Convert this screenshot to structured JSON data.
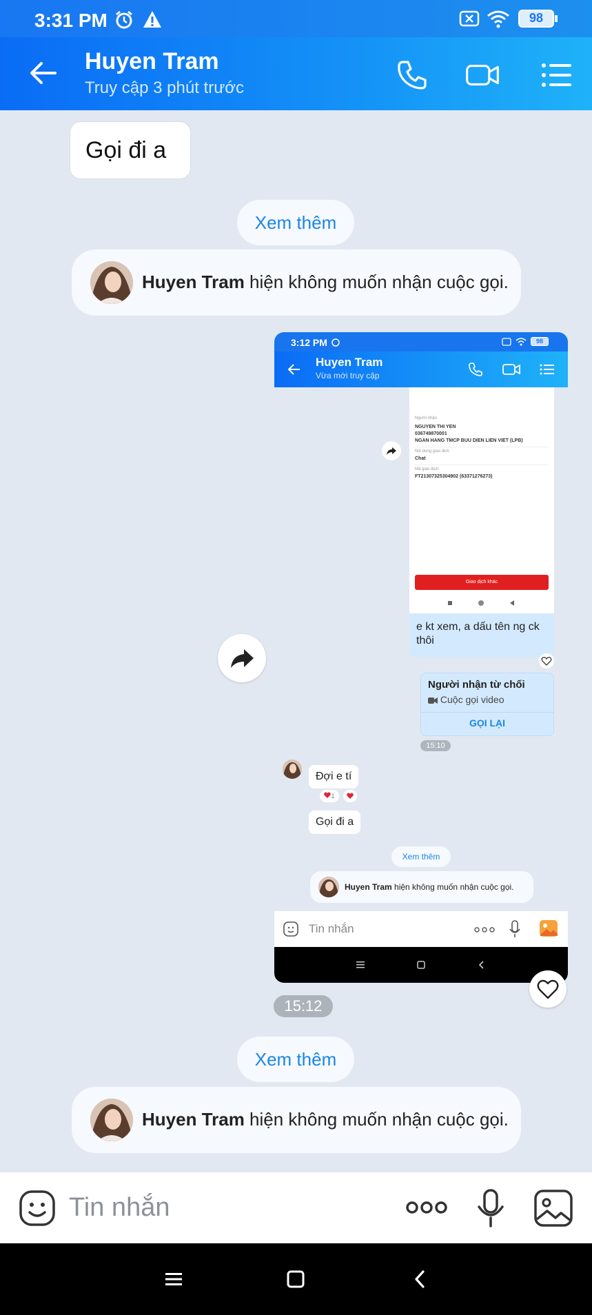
{
  "status_bar": {
    "time": "3:31 PM",
    "battery": "98",
    "icons": [
      "alarm-icon",
      "warning-icon",
      "no-sim-icon",
      "wifi-icon",
      "battery-icon"
    ]
  },
  "header": {
    "title": "Huyen Tram",
    "subtitle": "Truy cập 3 phút trước",
    "icons": [
      "back-arrow-icon",
      "phone-icon",
      "video-icon",
      "menu-list-icon"
    ]
  },
  "messages": {
    "bubble_text": "Gọi đi a",
    "see_more_1": "Xem thêm",
    "notice_1": {
      "name": "Huyen Tram",
      "text": " hiện không muốn nhận cuộc gọi."
    },
    "time_badge": "15:12",
    "see_more_2": "Xem thêm",
    "notice_2": {
      "name": "Huyen Tram",
      "text": " hiện không muốn nhận cuộc gọi."
    }
  },
  "shared_screenshot": {
    "status_time": "3:12 PM",
    "battery": "98",
    "title": "Huyen Tram",
    "subtitle": "Vừa mới truy cập",
    "receipt": {
      "label_receiver": "Người nhận",
      "receiver_name": "NGUYEN THI YEN",
      "account": "036749870001",
      "bank": "NGAN HANG TMCP BUU DIEN LIEN VIET (LPB)",
      "label_content": "Nội dung giao dịch",
      "content": "Chat",
      "label_code": "Mã giao dịch",
      "code": "FT21307325304902 (63371276273)",
      "button": "Giao dịch khác"
    },
    "reply_text": "e kt xem, a dấu tên ng ck thôi",
    "call_card": {
      "title": "Người nhận từ chối",
      "subtitle": "Cuộc gọi video",
      "action": "GỌI LẠI"
    },
    "time_badge": "15:10",
    "bubble_1": "Đợi e tí",
    "bubble_2": "Gọi đi a",
    "see_more": "Xem thêm",
    "notice": {
      "name": "Huyen Tram",
      "text": " hiện không muốn nhận cuộc gọi."
    },
    "input_placeholder": "Tin nhắn"
  },
  "input_bar": {
    "placeholder": "Tin nhắn",
    "icons": [
      "emoji-icon",
      "more-dots-icon",
      "microphone-icon",
      "image-icon"
    ]
  },
  "nav_bar": {
    "icons": [
      "menu-icon",
      "home-square-icon",
      "back-chevron-icon"
    ]
  },
  "colors": {
    "accent": "#1a86e8",
    "header_start": "#0a6cf5",
    "header_end": "#1fb2f9",
    "chat_bg": "#e2e8f1"
  }
}
